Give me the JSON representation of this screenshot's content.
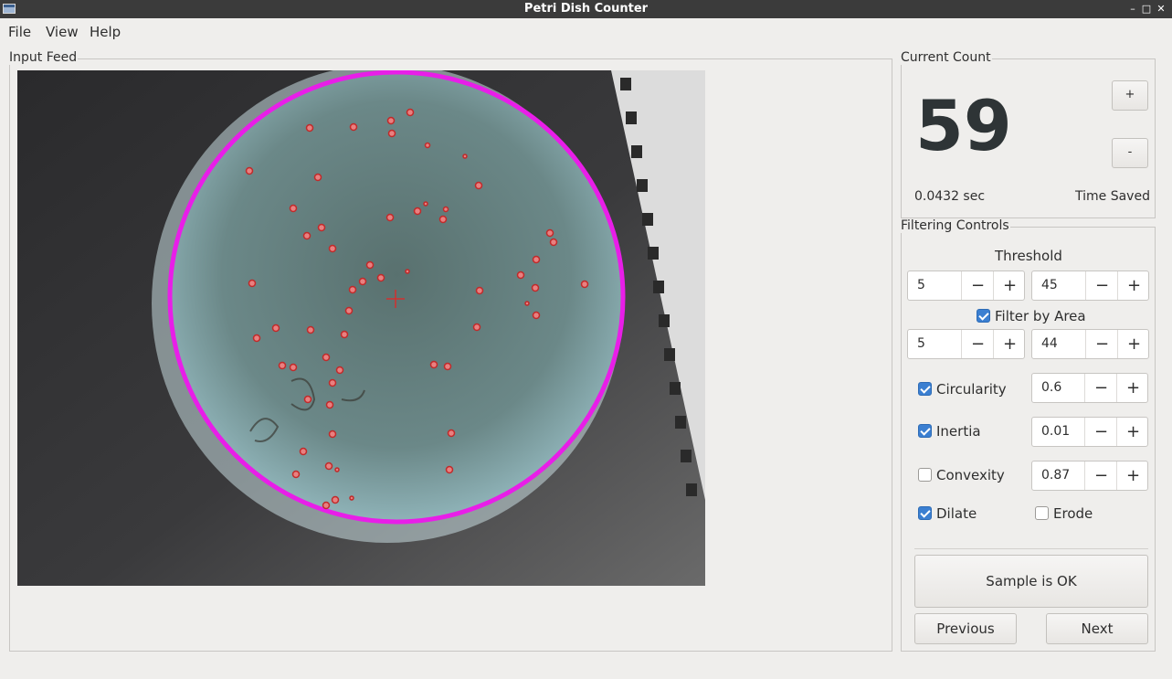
{
  "window": {
    "title": "Petri Dish Counter",
    "minimize": "–",
    "maximize": "□",
    "close": "✕"
  },
  "menu": [
    "File",
    "View",
    "Help"
  ],
  "input_feed": {
    "title": "Input Feed"
  },
  "current_count": {
    "title": "Current Count",
    "count": "59",
    "increment_label": "+",
    "decrement_label": "-",
    "time": "0.0432 sec",
    "time_saved_label": "Time Saved"
  },
  "filtering": {
    "title": "Filtering Controls",
    "threshold_label": "Threshold",
    "threshold_min": "5",
    "threshold_max": "45",
    "filter_by_area_label": "Filter by Area",
    "filter_by_area_checked": true,
    "area_min": "5",
    "area_max": "44",
    "circularity_label": "Circularity",
    "circularity_checked": true,
    "circularity_value": "0.6",
    "inertia_label": "Inertia",
    "inertia_checked": true,
    "inertia_value": "0.01",
    "convexity_label": "Convexity",
    "convexity_checked": false,
    "convexity_value": "0.87",
    "dilate_label": "Dilate",
    "dilate_checked": true,
    "erode_label": "Erode",
    "erode_checked": false,
    "minus": "−",
    "plus": "+"
  },
  "actions": {
    "sample_ok": "Sample is OK",
    "previous": "Previous",
    "next": "Next"
  },
  "colors": {
    "accent": "#3b7fd1",
    "dish_ring": "#e81ee8",
    "colony_marker": "#e23a3a"
  }
}
